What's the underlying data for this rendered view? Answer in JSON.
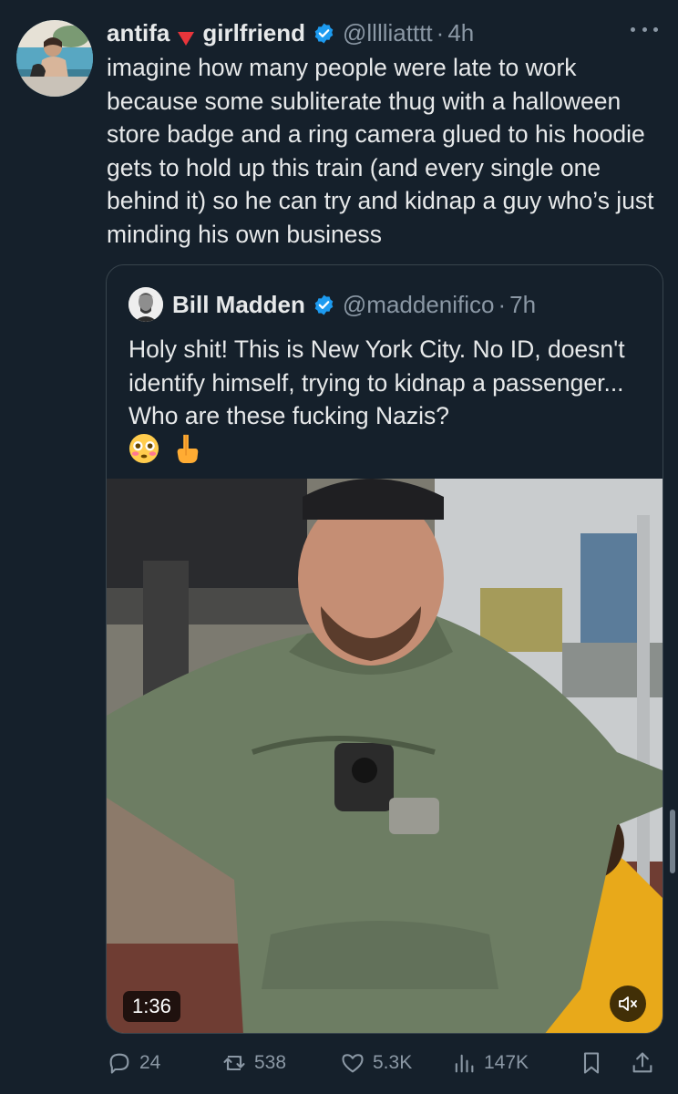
{
  "tweet": {
    "display_name_part1": "antifa",
    "display_name_part2": "girlfriend",
    "flag_icon": "red-triangle-down-emoji",
    "verified_icon": "verified-badge-icon",
    "handle": "@lllliatttt",
    "separator": "·",
    "time": "4h",
    "text": "imagine how many people were late to work because some subliterate thug with a halloween store badge and a ring camera glued to his hoodie gets to hold up this train (and every single one behind it) so he can try and kidnap a guy who’s just minding his own business"
  },
  "quote": {
    "display_name": "Bill Madden",
    "handle": "@maddenifico",
    "separator": "·",
    "time": "7h",
    "text": "Holy shit! This is New York City. No ID, doesn't identify himself, trying to kidnap a passenger... Who are these fucking Nazis?",
    "emojis": [
      "flushed-face-emoji",
      "pointing-down-emoji"
    ],
    "video": {
      "duration": "1:36",
      "muted": true
    }
  },
  "actions": {
    "replies": "24",
    "reposts": "538",
    "likes": "5.3K",
    "views": "147K"
  },
  "colors": {
    "background": "#15202b",
    "text": "#e7e9ea",
    "secondary": "#8b98a5",
    "verified": "#1d9bf0",
    "border": "#38444d"
  }
}
